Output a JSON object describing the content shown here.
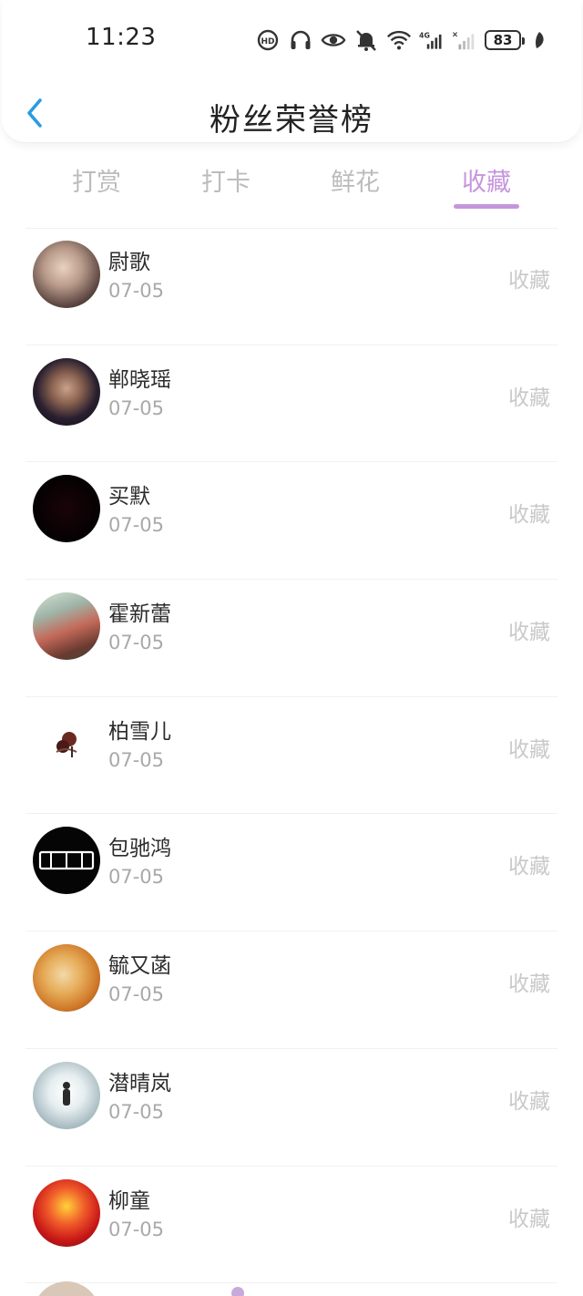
{
  "status_bar": {
    "time": "11:23",
    "battery": "83",
    "icons": [
      "hd-call-icon",
      "headphones-icon",
      "eye-icon",
      "mute-bell-icon",
      "wifi-icon",
      "signal-4g-icon",
      "signal-empty-icon",
      "leaf-icon"
    ]
  },
  "header": {
    "title": "粉丝荣誉榜",
    "back_icon": "chevron-left-icon"
  },
  "tabs": [
    {
      "label": "打赏",
      "active": false
    },
    {
      "label": "打卡",
      "active": false
    },
    {
      "label": "鲜花",
      "active": false
    },
    {
      "label": "收藏",
      "active": true
    }
  ],
  "fans": [
    {
      "name": "尉歌",
      "date": "07-05",
      "tag": "收藏"
    },
    {
      "name": "郸晓瑶",
      "date": "07-05",
      "tag": "收藏"
    },
    {
      "name": "买默",
      "date": "07-05",
      "tag": "收藏"
    },
    {
      "name": "霍新蕾",
      "date": "07-05",
      "tag": "收藏"
    },
    {
      "name": "柏雪儿",
      "date": "07-05",
      "tag": "收藏"
    },
    {
      "name": "包驰鸿",
      "date": "07-05",
      "tag": "收藏"
    },
    {
      "name": "毓又菡",
      "date": "07-05",
      "tag": "收藏"
    },
    {
      "name": "潜晴岚",
      "date": "07-05",
      "tag": "收藏"
    },
    {
      "name": "柳童",
      "date": "07-05",
      "tag": "收藏"
    }
  ],
  "colors": {
    "accent": "#c696dc",
    "back_arrow": "#2a9be0",
    "tab_inactive": "#bcbcbc",
    "tag_text": "#c9c9c9"
  }
}
